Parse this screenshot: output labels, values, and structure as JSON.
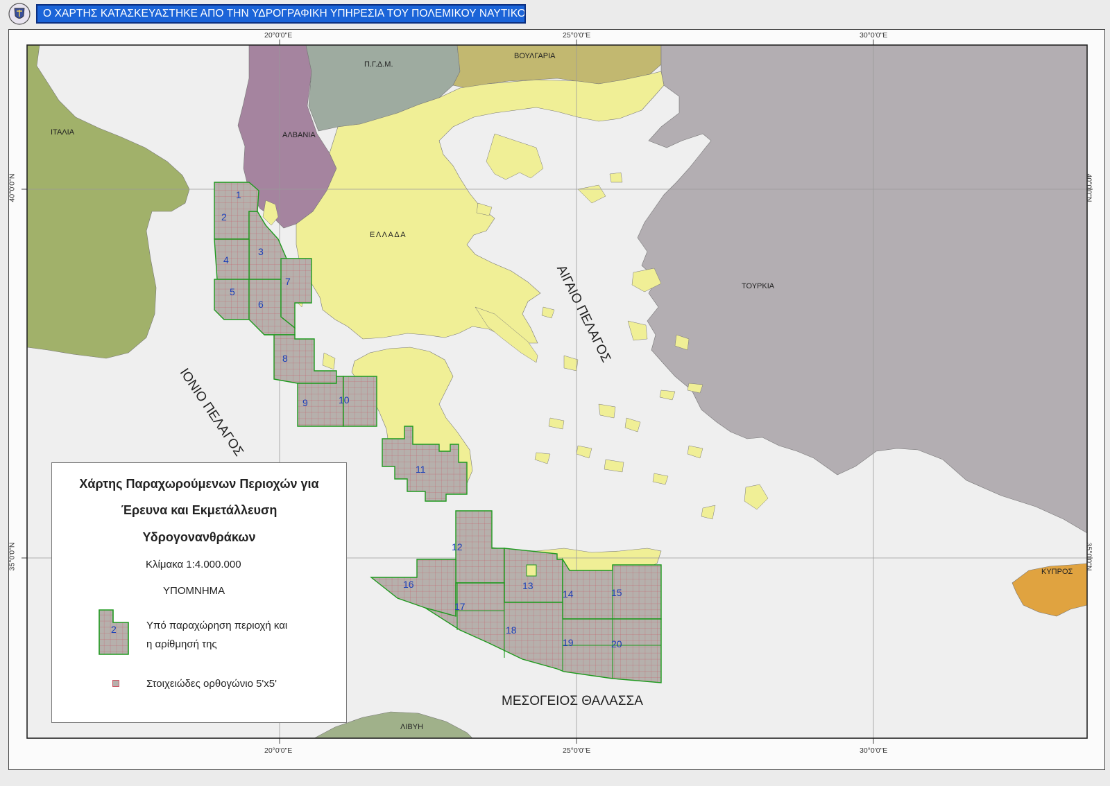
{
  "header": {
    "banner_text": "Ο ΧΑΡΤΗΣ ΚΑΤΑΣΚΕΥΑΣΤΗΚΕ ΑΠΟ ΤΗΝ ΥΔΡΟΓΡΑΦΙΚΗ ΥΠΗΡΕΣΙΑ ΤΟΥ ΠΟΛΕΜΙΚΟΥ ΝΑΥΤΙΚΟΥ",
    "emblem_icon": "hydrographic-service-emblem-icon"
  },
  "graticule": {
    "lon_labels": [
      "20°0'0\"E",
      "25°0'0\"E",
      "30°0'0\"E"
    ],
    "lat_labels": [
      "40°0'0\"N",
      "35°0'0\"N"
    ]
  },
  "countries": {
    "italy": "ΙΤΑΛΙΑ",
    "albania": "ΑΛΒΑΝΙΑ",
    "fyrom": "Π.Γ.Δ.Μ.",
    "bulgaria": "ΒΟΥΛΓΑΡΙΑ",
    "greece": "ΕΛΛΑΔΑ",
    "turkey": "ΤΟΥΡΚΙΑ",
    "cyprus": "ΚΥΠΡΟΣ",
    "libya": "ΛΙΒΥΗ"
  },
  "seas": {
    "ionian": "ΙΟΝΙΟ ΠΕΛΑΓΟΣ",
    "aegean": "ΑΙΓΑΙΟ ΠΕΛΑΓΟΣ",
    "mediterranean": "ΜΕΣΟΓΕΙΟΣ ΘΑΛΑΣΣΑ"
  },
  "blocks": [
    "1",
    "2",
    "3",
    "4",
    "5",
    "6",
    "7",
    "8",
    "9",
    "10",
    "11",
    "12",
    "13",
    "14",
    "15",
    "16",
    "17",
    "18",
    "19",
    "20"
  ],
  "legend": {
    "title_line1": "Χάρτης Παραχωρούμενων Περιοχών για",
    "title_line2": "Έρευνα και Εκμετάλλευση",
    "title_line3": "Υδρογονανθράκων",
    "scale": "Κλίμακα 1:4.000.000",
    "heading": "ΥΠΟΜΝΗΜΑ",
    "sample_block_number": "2",
    "item1_line1": "Υπό παραχώρηση περιοχή και",
    "item1_line2": "η αρίθμησή της",
    "item2": "Στοιχειώδες ορθογώνιο 5'x5'"
  },
  "colors": {
    "banner": "#1b64d8",
    "greece": "#f0ef96",
    "turkey": "#b3aeb2",
    "italy": "#a1b16a",
    "albania": "#a5849f",
    "fyrom": "#9eaba0",
    "bulgaria": "#c2b870",
    "cyprus": "#e0a340",
    "libya": "#a0b18a",
    "block_fill": "#b6b0ac",
    "block_border": "#1e9a1e",
    "block_number": "#1a3fb8"
  }
}
